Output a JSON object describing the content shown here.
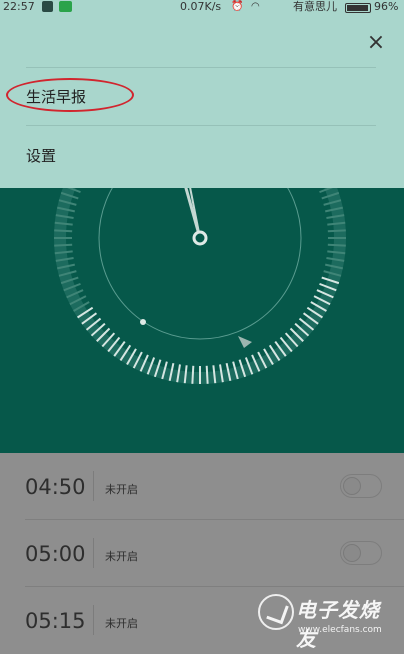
{
  "status_bar": {
    "time": "22:57",
    "net_speed": "0.07K/s",
    "dnd_label": "有意思儿",
    "battery": "96%",
    "battery_level": 0.96,
    "icons": [
      "notification-icon",
      "wechat-icon",
      "alarm-clock-icon",
      "wifi-icon",
      "battery-icon"
    ]
  },
  "menu": {
    "close_label": "×",
    "items": [
      {
        "label": "生活早报"
      },
      {
        "label": "设置"
      }
    ],
    "highlight_color": "#d1252e"
  },
  "alarms": [
    {
      "time": "04:50",
      "status": "未开启",
      "enabled": false
    },
    {
      "time": "05:00",
      "status": "未开启",
      "enabled": false
    },
    {
      "time": "05:15",
      "status": "未开启",
      "enabled": false
    }
  ],
  "watermark": {
    "text": "电子发烧友",
    "url": "www.elecfans.com"
  },
  "colors": {
    "menu_bg": "#a9d6cc",
    "dial_bg": "#06584a",
    "list_bg": "#8e8e8e"
  }
}
